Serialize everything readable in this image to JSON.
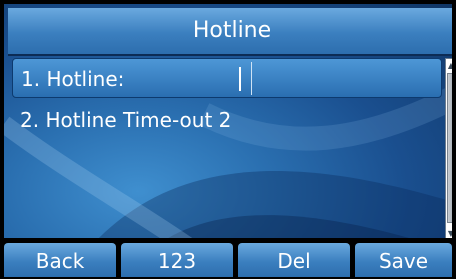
{
  "screen": {
    "title": "Hotline"
  },
  "list": {
    "items": [
      {
        "label": "1. Hotline:",
        "value": ""
      },
      {
        "label": "2. Hotline Time-out 2"
      }
    ]
  },
  "softkeys": {
    "back": "Back",
    "ime": "123",
    "del": "Del",
    "save": "Save"
  },
  "colors": {
    "background": "#1a4f8f",
    "title_bar": "#3b7fbf",
    "text": "#ffffff"
  }
}
